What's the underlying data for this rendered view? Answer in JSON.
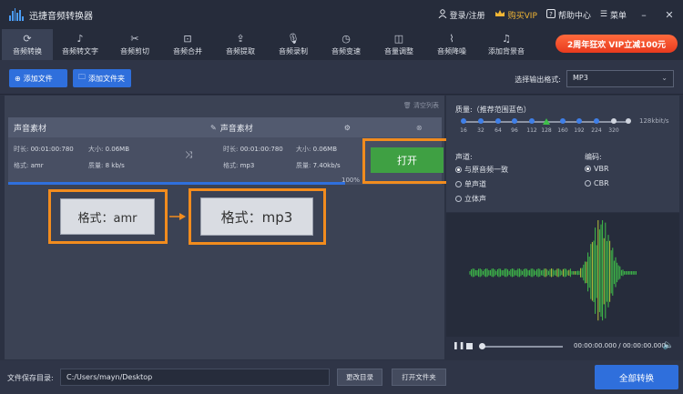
{
  "app": {
    "title": "迅捷音频转换器"
  },
  "topbar": {
    "login": "登录/注册",
    "vip": "购买VIP",
    "help": "帮助中心",
    "menu": "菜单"
  },
  "tabs": [
    {
      "label": "音频转换",
      "icon": "refresh-icon",
      "active": true
    },
    {
      "label": "音频转文字",
      "icon": "audio-text-icon"
    },
    {
      "label": "音频剪切",
      "icon": "scissors-icon"
    },
    {
      "label": "音频合并",
      "icon": "merge-icon"
    },
    {
      "label": "音频提取",
      "icon": "extract-icon"
    },
    {
      "label": "音频录制",
      "icon": "microphone-icon"
    },
    {
      "label": "音频变速",
      "icon": "speed-icon"
    },
    {
      "label": "音量调整",
      "icon": "volume-adjust-icon"
    },
    {
      "label": "音频降噪",
      "icon": "denoise-icon"
    },
    {
      "label": "添加背景音",
      "icon": "add-music-icon"
    }
  ],
  "promo": {
    "text": "2周年狂欢 VIP立减100元"
  },
  "toolbar": {
    "add_file": "添加文件",
    "add_folder": "添加文件夹",
    "format_label": "选择输出格式:",
    "format_value": "MP3"
  },
  "filelist": {
    "clear": "清空列表",
    "source": {
      "name": "声音素材",
      "duration_label": "时长:",
      "duration": "00:01:00:780",
      "size_label": "大小:",
      "size": "0.06MB",
      "format_label": "格式:",
      "format": "amr",
      "quality_label": "质量:",
      "quality": "8 kb/s"
    },
    "target": {
      "name": "声音素材",
      "duration_label": "时长:",
      "duration": "00:01:00:780",
      "size_label": "大小:",
      "size": "0.06MB",
      "format_label": "格式:",
      "format": "mp3",
      "quality_label": "质量:",
      "quality": "7.40kb/s"
    },
    "progress": "100%",
    "open_button": "打开"
  },
  "annotation": {
    "from": "格式：amr",
    "to": "格式：mp3"
  },
  "settings": {
    "quality_label": "质量:（推荐范围蓝色）",
    "quality_ticks": [
      "16",
      "32",
      "64",
      "96",
      "112",
      "128",
      "160",
      "192",
      "224",
      "320"
    ],
    "quality_value": "128kbit/s",
    "channel_label": "声道:",
    "channels": [
      "与原音频一致",
      "单声道",
      "立体声"
    ],
    "encoding_label": "编码:",
    "encodings": [
      "VBR",
      "CBR"
    ]
  },
  "player": {
    "time": "00:00:00.000 / 00:00:00.000"
  },
  "bottom": {
    "save_label": "文件保存目录:",
    "path": "C:/Users/mayn/Desktop",
    "change_dir": "更改目录",
    "open_folder": "打开文件夹",
    "convert_all": "全部转换"
  }
}
